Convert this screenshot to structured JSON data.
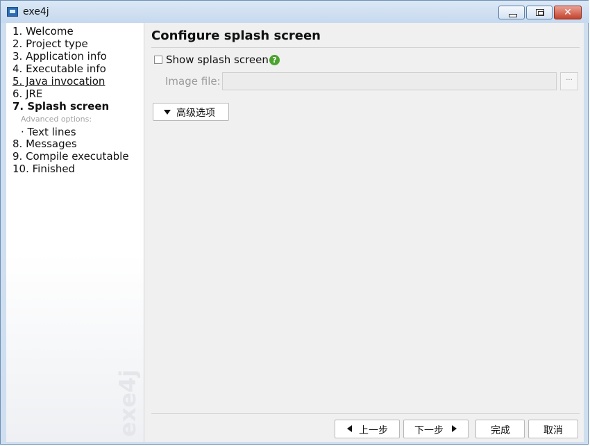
{
  "window": {
    "title": "exe4j",
    "close_glyph": "✕"
  },
  "sidebar": {
    "steps": [
      {
        "label": "1. Welcome"
      },
      {
        "label": "2. Project type"
      },
      {
        "label": "3. Application info"
      },
      {
        "label": "4. Executable info"
      },
      {
        "label": "5. Java invocation"
      },
      {
        "label": "6. JRE"
      },
      {
        "label": "7. Splash screen"
      },
      {
        "label": "8. Messages"
      },
      {
        "label": "9. Compile executable"
      },
      {
        "label": "10. Finished"
      }
    ],
    "advanced_label": "Advanced options:",
    "sub_step": "· Text lines"
  },
  "main": {
    "heading": "Configure splash screen",
    "show_splash_label": "Show splash screen",
    "show_splash_checked": false,
    "help_glyph": "?",
    "image_file_label": "Image file:",
    "image_file_value": "",
    "browse_label": "···",
    "advanced_button": "高级选项"
  },
  "footer": {
    "back": "上一步",
    "next": "下一步",
    "finish": "完成",
    "cancel": "取消"
  },
  "icons": {
    "app": "app-icon",
    "minimize": "minimize-icon",
    "maximize": "maximize-icon",
    "close": "close-icon",
    "help": "help-icon",
    "expand": "triangle-down-icon",
    "back": "triangle-left-icon",
    "next": "triangle-right-icon"
  },
  "colors": {
    "help": "#4aa32e",
    "titlebar": "#cfdff0",
    "close_button": "#c4412b"
  }
}
